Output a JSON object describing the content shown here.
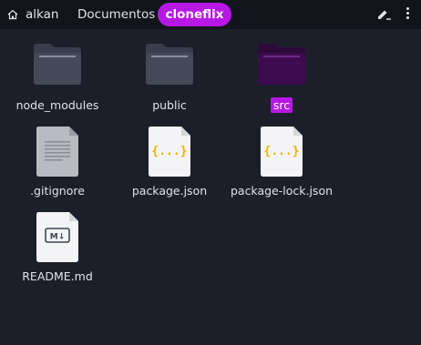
{
  "pathbar": {
    "home_label": "alkan",
    "crumbs": [
      "Documentos"
    ],
    "active": "cloneflix"
  },
  "files": [
    {
      "name": "node_modules",
      "type": "folder"
    },
    {
      "name": "public",
      "type": "folder"
    },
    {
      "name": "src",
      "type": "folder",
      "selected": true
    },
    {
      "name": ".gitignore",
      "type": "text"
    },
    {
      "name": "package.json",
      "type": "json"
    },
    {
      "name": "package-lock.json",
      "type": "json"
    },
    {
      "name": "README.md",
      "type": "markdown"
    }
  ],
  "icons": {
    "json_glyph": "{...}",
    "md_glyph": "M↓"
  },
  "colors": {
    "background": "#1c1f2a",
    "accent": "#b818e6",
    "folder": "#3f4252",
    "folder_selected": "#3d0a4f",
    "json_brace": "#e6b400"
  }
}
